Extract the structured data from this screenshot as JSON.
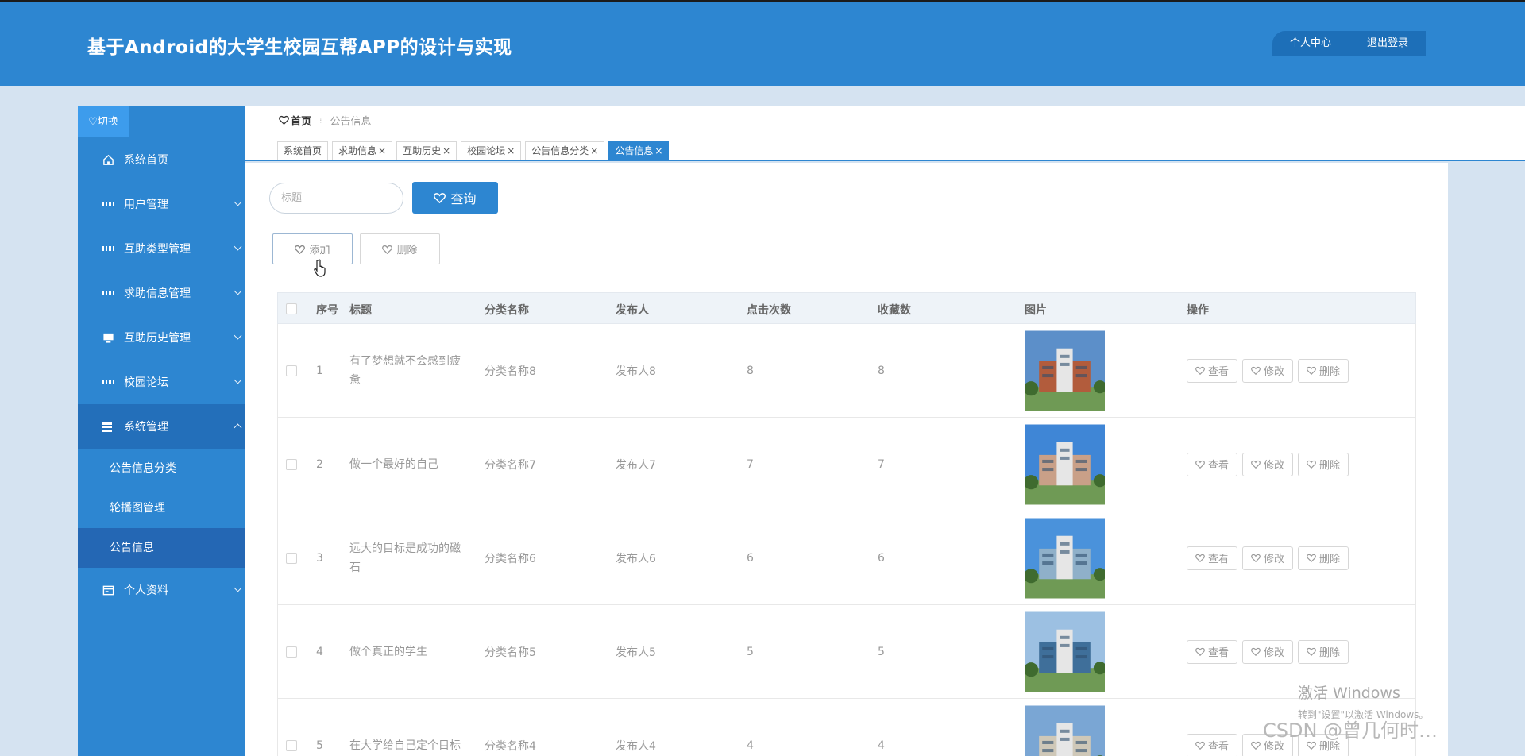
{
  "header": {
    "title": "基于Android的大学生校园互帮APP的设计与实现",
    "personal_center": "个人中心",
    "logout": "退出登录"
  },
  "sidebar": {
    "toggle": "♡切换",
    "items": [
      {
        "label": "系统首页",
        "icon": "home-icon"
      },
      {
        "label": "用户管理",
        "icon": "grid-icon"
      },
      {
        "label": "互助类型管理",
        "icon": "grid-icon"
      },
      {
        "label": "求助信息管理",
        "icon": "grid-icon"
      },
      {
        "label": "互助历史管理",
        "icon": "monitor-icon"
      },
      {
        "label": "校园论坛",
        "icon": "grid-icon"
      },
      {
        "label": "系统管理",
        "icon": "list-icon"
      },
      {
        "label": "个人资料",
        "icon": "card-icon"
      }
    ],
    "sub_items": [
      "公告信息分类",
      "轮播图管理",
      "公告信息"
    ]
  },
  "breadcrumb": {
    "home": "首页",
    "separator": "⁝",
    "current": "公告信息"
  },
  "tabs": [
    {
      "label": "系统首页",
      "closable": false
    },
    {
      "label": "求助信息",
      "closable": true
    },
    {
      "label": "互助历史",
      "closable": true
    },
    {
      "label": "校园论坛",
      "closable": true
    },
    {
      "label": "公告信息分类",
      "closable": true
    },
    {
      "label": "公告信息",
      "closable": true,
      "active": true
    }
  ],
  "tab_close": "×",
  "search": {
    "placeholder": "标题",
    "button": "查询"
  },
  "actions": {
    "add": "添加",
    "delete": "删除"
  },
  "table": {
    "columns": [
      "序号",
      "标题",
      "分类名称",
      "发布人",
      "点击次数",
      "收藏数",
      "图片",
      "操作"
    ],
    "rows": [
      {
        "no": "1",
        "title": "有了梦想就不会感到疲惫",
        "category": "分类名称8",
        "publisher": "发布人8",
        "clicks": "8",
        "favorites": "8"
      },
      {
        "no": "2",
        "title": "做一个最好的自己",
        "category": "分类名称7",
        "publisher": "发布人7",
        "clicks": "7",
        "favorites": "7"
      },
      {
        "no": "3",
        "title": "远大的目标是成功的磁石",
        "category": "分类名称6",
        "publisher": "发布人6",
        "clicks": "6",
        "favorites": "6"
      },
      {
        "no": "4",
        "title": "做个真正的学生",
        "category": "分类名称5",
        "publisher": "发布人5",
        "clicks": "5",
        "favorites": "5"
      },
      {
        "no": "5",
        "title": "在大学给自己定个目标",
        "category": "分类名称4",
        "publisher": "发布人4",
        "clicks": "4",
        "favorites": "4"
      }
    ],
    "ops": {
      "view": "查看",
      "edit": "修改",
      "delete": "删除"
    }
  },
  "watermark": {
    "line1": "激活 Windows",
    "line2": "转到\"设置\"以激活 Windows。",
    "csdn": "CSDN @曾几何时…"
  },
  "colors": {
    "primary": "#2d86d1",
    "sidebar_active": "#2467b4",
    "page_bg": "#d5e3f1"
  }
}
